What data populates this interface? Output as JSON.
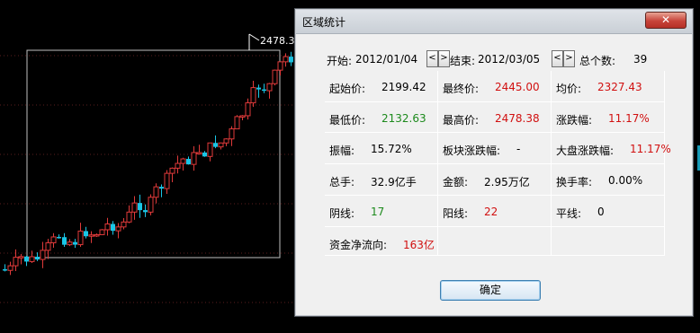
{
  "dialog": {
    "title": "区域统计",
    "close_label": "✕",
    "start_label": "开始:",
    "start_value": "2012/01/04",
    "end_label": "结束:",
    "end_value": "2012/03/05",
    "count_label": "总个数:",
    "count_value": "39",
    "prev_glyph": "<",
    "next_glyph": ">",
    "ok_label": "确定",
    "stats": [
      {
        "label": "起始价:",
        "value": "2199.42",
        "color": "#000000"
      },
      {
        "label": "最终价:",
        "value": "2445.00",
        "color": "#d11010"
      },
      {
        "label": "均价:",
        "value": "2327.43",
        "color": "#d11010"
      },
      {
        "label": "最低价:",
        "value": "2132.63",
        "color": "#1c8a1c"
      },
      {
        "label": "最高价:",
        "value": "2478.38",
        "color": "#d11010"
      },
      {
        "label": "涨跌幅:",
        "value": "11.17%",
        "color": "#d11010"
      },
      {
        "label": "振幅:",
        "value": "15.72%",
        "color": "#000000"
      },
      {
        "label": "板块涨跌幅:",
        "value": "-",
        "color": "#000000"
      },
      {
        "label": "大盘涨跌幅:",
        "value": "11.17%",
        "color": "#d11010"
      },
      {
        "label": "总手:",
        "value": "32.9亿手",
        "color": "#000000"
      },
      {
        "label": "金额:",
        "value": "2.95万亿",
        "color": "#000000"
      },
      {
        "label": "换手率:",
        "value": "0.00%",
        "color": "#000000"
      },
      {
        "label": "阴线:",
        "value": "17",
        "color": "#1c8a1c"
      },
      {
        "label": "阳线:",
        "value": "22",
        "color": "#d11010"
      },
      {
        "label": "平线:",
        "value": "0",
        "color": "#000000"
      },
      {
        "label": "资金净流向:",
        "value": "163亿",
        "color": "#d11010"
      }
    ]
  },
  "chart": {
    "high_marker_label": "2478.3",
    "up_color": "#e03a3a",
    "down_color": "#19c6e6"
  }
}
